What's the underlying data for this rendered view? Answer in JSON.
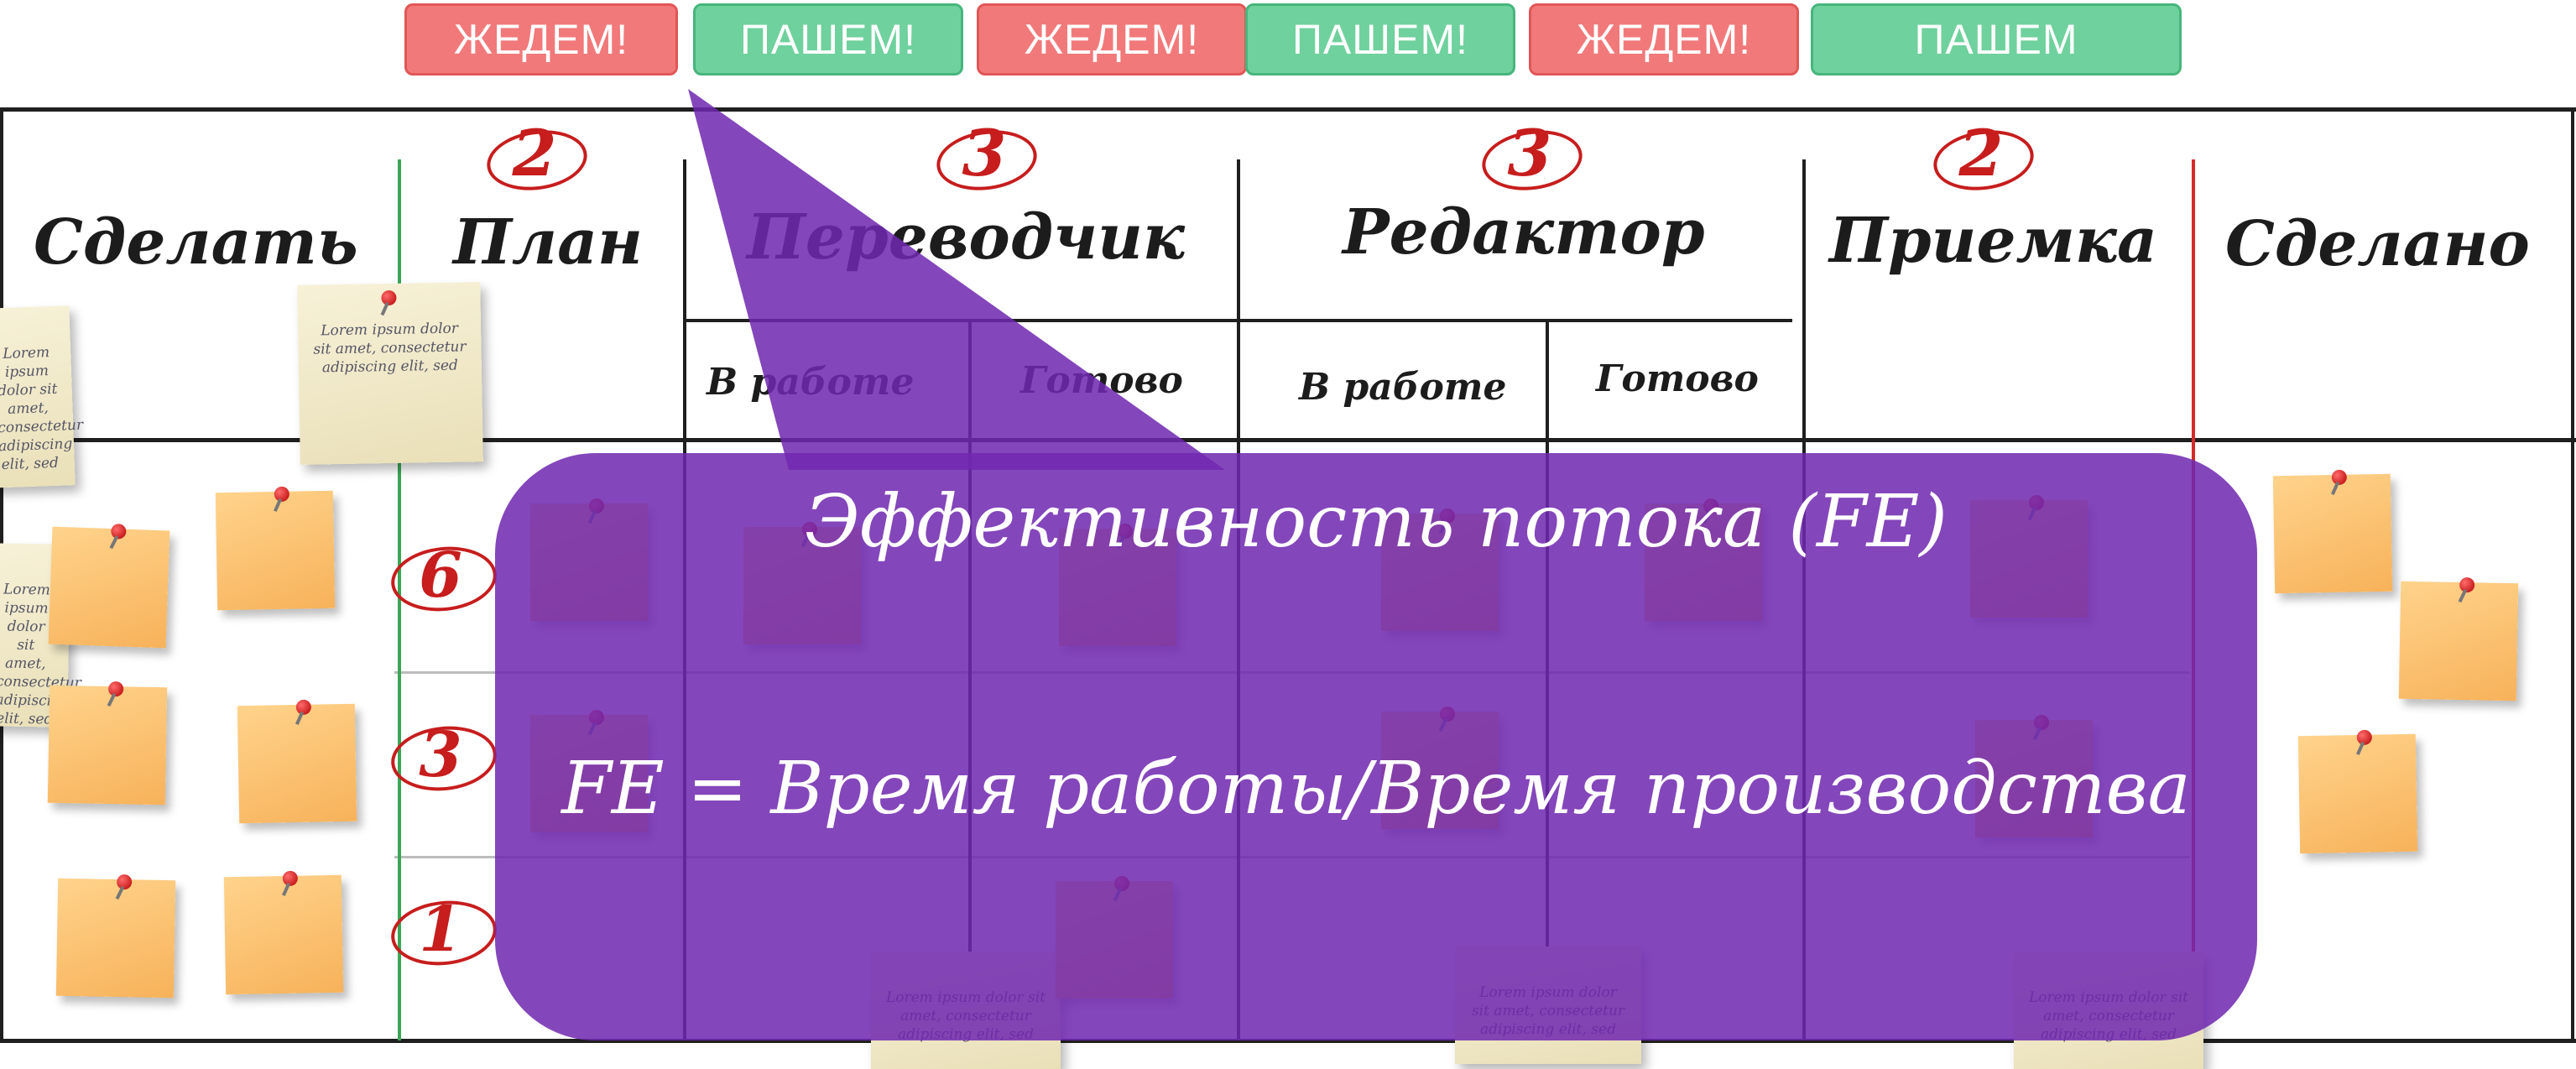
{
  "status_bar": [
    {
      "label": "ЖЕДЕМ!",
      "state": "wait"
    },
    {
      "label": "ПАШЕМ!",
      "state": "push"
    },
    {
      "label": "ЖЕДЕМ!",
      "state": "wait"
    },
    {
      "label": "ПАШЕМ!",
      "state": "push"
    },
    {
      "label": "ЖЕДЕМ!",
      "state": "wait"
    },
    {
      "label": "ПАШЕМ",
      "state": "push"
    }
  ],
  "columns": [
    {
      "title": "Сделать"
    },
    {
      "title": "План",
      "wip_limit": "2"
    },
    {
      "title": "Переводчик",
      "wip_limit": "3",
      "sub": [
        "В работе",
        "Готово"
      ]
    },
    {
      "title": "Редактор",
      "wip_limit": "3",
      "sub": [
        "В работе",
        "Готово"
      ]
    },
    {
      "title": "Приемка",
      "wip_limit": "2"
    },
    {
      "title": "Сделано"
    }
  ],
  "lanes": [
    "6",
    "3",
    "1"
  ],
  "paper_note_text": "Lorem ipsum dolor sit amet, consectetur adipiscing elit, sed",
  "callout": {
    "title": "Эффективность потока (FE)",
    "formula": "FE = Время работы/Время производства"
  },
  "colors": {
    "wait": "#f2797a",
    "push": "#6fd19d",
    "callout": "#7028b0",
    "wip_red": "#c71d1d",
    "plan_divider": "#3aa655",
    "done_divider": "#d62a2a"
  }
}
